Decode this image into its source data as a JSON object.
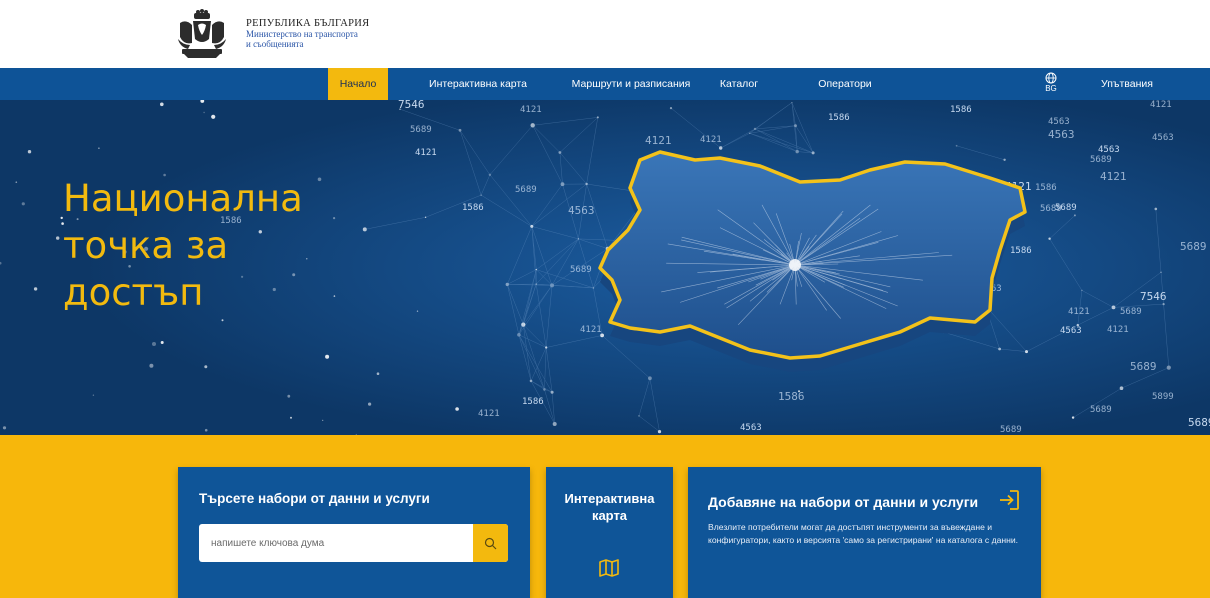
{
  "header": {
    "crest_icon": "bulgarian-coat-of-arms-icon",
    "ministry_line1": "РЕПУБЛИКА БЪЛГАРИЯ",
    "ministry_line2": "Министерство на транспорта",
    "ministry_line3": "и съобщенията"
  },
  "nav": {
    "items": [
      {
        "label": "Начало",
        "active": true
      },
      {
        "label": "Интерактивна карта",
        "active": false
      },
      {
        "label": "Маршрути и разписания",
        "active": false
      },
      {
        "label": "Каталог",
        "active": false
      },
      {
        "label": "Оператори",
        "active": false
      }
    ],
    "language": {
      "icon": "globe-icon",
      "code": "BG"
    },
    "help": "Упътвания"
  },
  "hero": {
    "title_line1": "Национална",
    "title_line2": "точка за",
    "title_line3": "достъп",
    "map_icon": "bulgaria-map-illustration",
    "floating_numbers": [
      "7546",
      "5689",
      "4121",
      "4121",
      "4121",
      "4121",
      "1586",
      "4563",
      "4563",
      "4563",
      "4121",
      "5689",
      "4121",
      "1586",
      "5689",
      "1586",
      "4563",
      "5689",
      "4563",
      "5689",
      "5689",
      "1586",
      "4121",
      "4563",
      "7546",
      "4121",
      "5689",
      "4563",
      "5689",
      "1586",
      "1586",
      "4121",
      "1586",
      "4563",
      "5689",
      "5899",
      "5689",
      "4121",
      "5689",
      "1586",
      "4121",
      "4563",
      "5689"
    ]
  },
  "cards": {
    "search": {
      "title": "Търсете набори от данни и услуги",
      "placeholder": "напишете ключова дума",
      "icon": "search-icon"
    },
    "map": {
      "title": "Интерактивна карта",
      "icon": "map-icon"
    },
    "add": {
      "title": "Добавяне на набори от данни и услуги",
      "icon": "login-arrow-icon",
      "description": "Влезлите потребители могат да достъпят инструменти за въвеждане и конфигуратори, както и версията 'само за регистрирани' на каталога с данни."
    }
  },
  "colors": {
    "nav_blue": "#0e5397",
    "hero_blue": "#0e3b70",
    "accent_yellow": "#f3b90e",
    "band_yellow": "#f7b70b",
    "card_blue": "#0f5598"
  }
}
